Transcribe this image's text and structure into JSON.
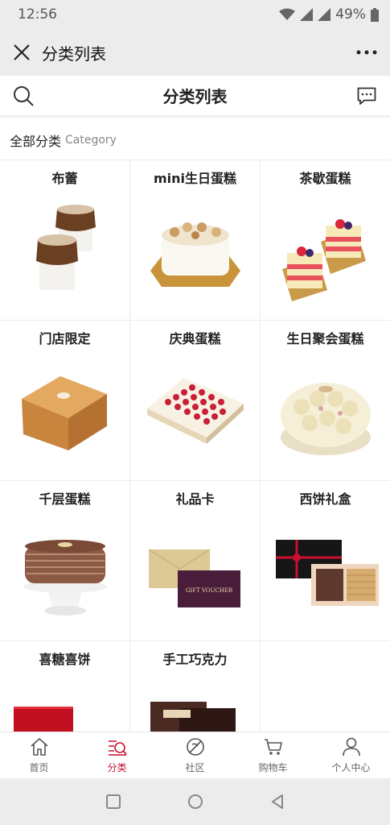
{
  "status_bar": {
    "time": "12:56",
    "battery": "49%"
  },
  "title_bar": {
    "title": "分类列表"
  },
  "page_header": {
    "title": "分类列表"
  },
  "category_header": {
    "zh": "全部分类",
    "en": "Category"
  },
  "categories": [
    {
      "name": "布蕾",
      "icon": "pudding-image"
    },
    {
      "name": "mini生日蛋糕",
      "icon": "mini-cake-image"
    },
    {
      "name": "茶歇蛋糕",
      "icon": "tea-cake-image"
    },
    {
      "name": "门店限定",
      "icon": "store-limited-cake-image"
    },
    {
      "name": "庆典蛋糕",
      "icon": "celebration-cake-image"
    },
    {
      "name": "生日聚会蛋糕",
      "icon": "party-cake-image"
    },
    {
      "name": "千层蛋糕",
      "icon": "crepe-cake-image"
    },
    {
      "name": "礼品卡",
      "icon": "gift-card-image"
    },
    {
      "name": "西饼礼盒",
      "icon": "cookie-box-image"
    },
    {
      "name": "喜糖喜饼",
      "icon": "wedding-candy-image"
    },
    {
      "name": "手工巧克力",
      "icon": "chocolate-box-image"
    }
  ],
  "gift_card_text": "GIFT VOUCHER",
  "tabs": [
    {
      "label": "首页",
      "icon": "home-icon",
      "active": false
    },
    {
      "label": "分类",
      "icon": "category-icon",
      "active": true
    },
    {
      "label": "社区",
      "icon": "community-icon",
      "active": false
    },
    {
      "label": "购物车",
      "icon": "cart-icon",
      "active": false
    },
    {
      "label": "个人中心",
      "icon": "profile-icon",
      "active": false
    }
  ],
  "colors": {
    "accent": "#c8102e",
    "bar_bg": "#ececec"
  }
}
